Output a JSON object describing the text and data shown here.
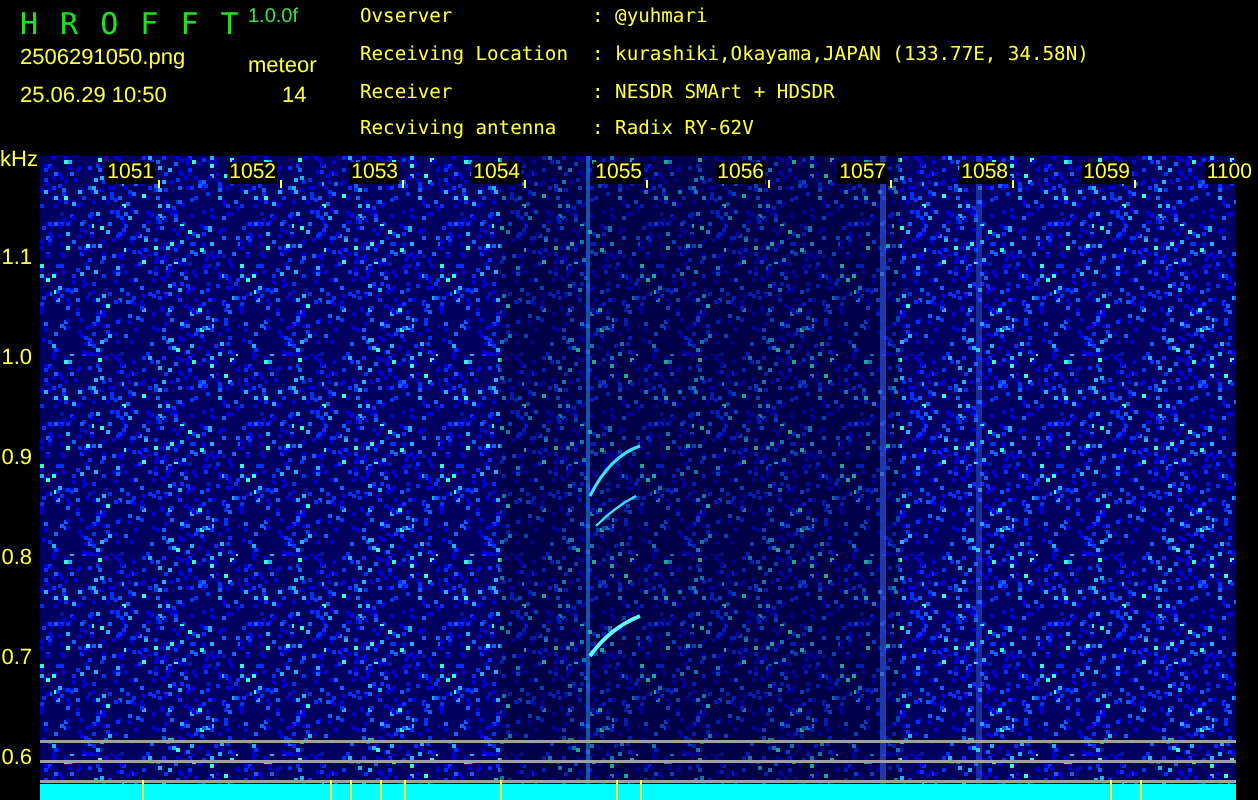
{
  "header": {
    "program": "H R O F F T",
    "version": "1.0.0f",
    "filename": "2506291050.png",
    "timestamp": "25.06.29 10:50",
    "mode": "meteor",
    "count": "14"
  },
  "station": [
    {
      "label": "Ovserver",
      "value": ": @yuhmari"
    },
    {
      "label": "Receiving Location",
      "value": ": kurashiki,Okayama,JAPAN (133.77E, 34.58N)"
    },
    {
      "label": "Receiver",
      "value": ": NESDR SMArt + HDSDR"
    },
    {
      "label": "Recviving antenna",
      "value": ": Radix RY-62V"
    }
  ],
  "spectrogram": {
    "y_unit": "kHz",
    "y_labels": [
      "1.1",
      "1.0",
      "0.9",
      "0.8",
      "0.7",
      "0.6"
    ],
    "x_labels": [
      "1051",
      "1052",
      "1053",
      "1054",
      "1055",
      "1056",
      "1057",
      "1058",
      "1059",
      "1100"
    ]
  }
}
